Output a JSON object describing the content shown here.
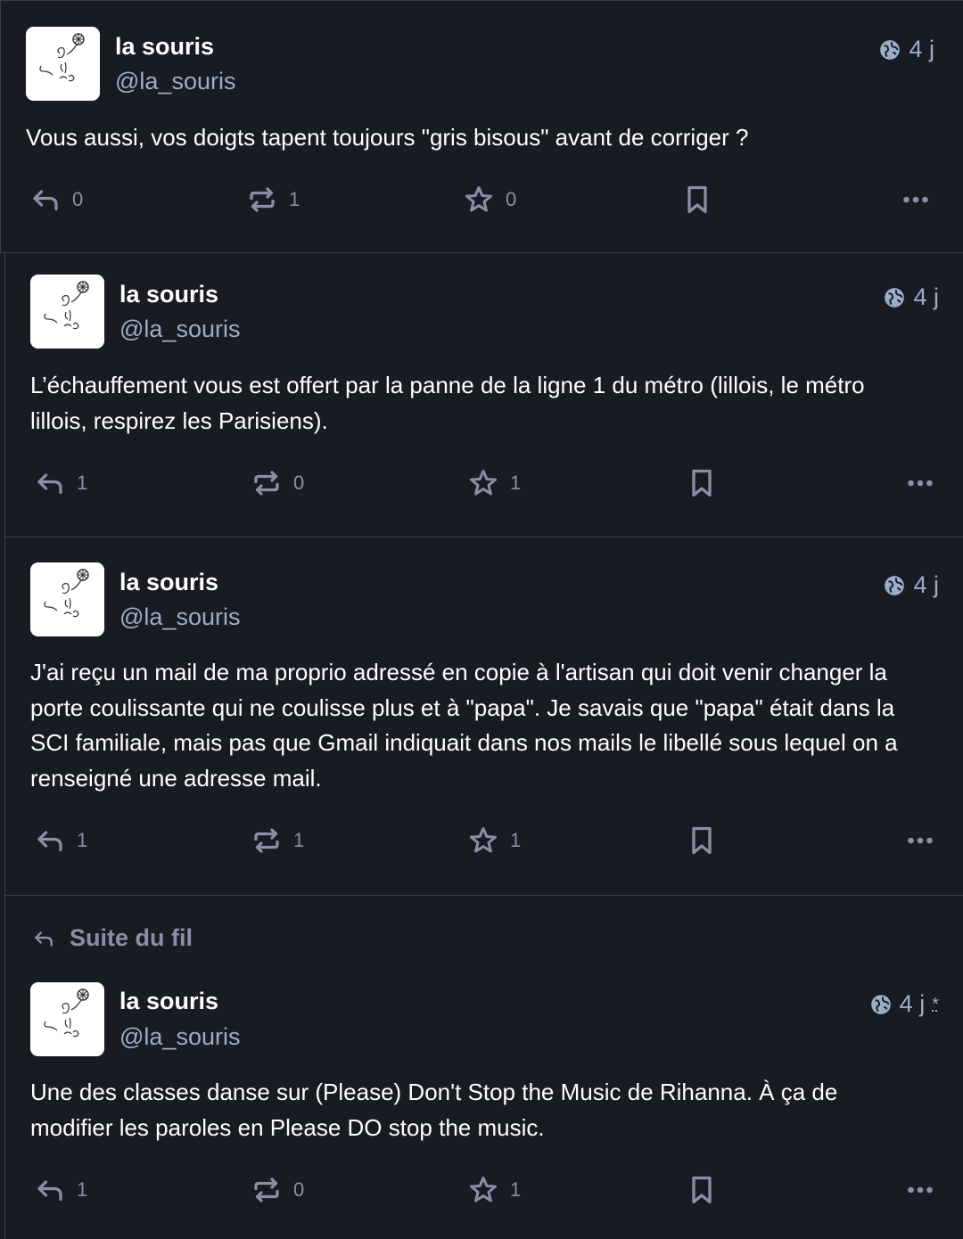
{
  "posts": [
    {
      "display_name": "la souris",
      "handle": "@la_souris",
      "visibility_icon": "globe-icon",
      "time": "4 j",
      "content": "Vous aussi, vos doigts tapent toujours \"gris bisous\" avant de corriger ?",
      "counts": {
        "reply": "0",
        "boost": "1",
        "favourite": "0"
      }
    },
    {
      "display_name": "la souris",
      "handle": "@la_souris",
      "visibility_icon": "globe-icon",
      "time": "4 j",
      "content": "L’échauffement vous est offert par la panne de la ligne 1 du métro (lillois, le métro\nlillois, respirez les Parisiens).",
      "counts": {
        "reply": "1",
        "boost": "0",
        "favourite": "1"
      }
    },
    {
      "display_name": "la souris",
      "handle": "@la_souris",
      "visibility_icon": "globe-icon",
      "time": "4 j",
      "content": "J'ai reçu un mail de ma proprio adressé en copie à l'artisan qui doit venir changer la\nporte coulissante qui ne coulisse plus et à \"papa\". Je savais que \"papa\" était dans la\nSCI familiale, mais pas que Gmail indiquait dans nos mails le libellé sous lequel on a\nrenseigné une adresse mail.",
      "counts": {
        "reply": "1",
        "boost": "1",
        "favourite": "1"
      }
    },
    {
      "thread_label": "Suite du fil",
      "display_name": "la souris",
      "handle": "@la_souris",
      "visibility_icon": "globe-icon",
      "time": "4 j",
      "edited_mark": "*",
      "content": "Une des classes danse sur (Please) Don't Stop the Music de Rihanna. À ça de\nmodifier les paroles en Please DO stop the music.",
      "counts": {
        "reply": "1",
        "boost": "0",
        "favourite": "1"
      }
    }
  ],
  "colors": {
    "background": "#191b22",
    "divider": "#393f4f",
    "text": "#ffffff",
    "secondary_text": "#9baec8",
    "action_icon": "#8a8fa8"
  }
}
